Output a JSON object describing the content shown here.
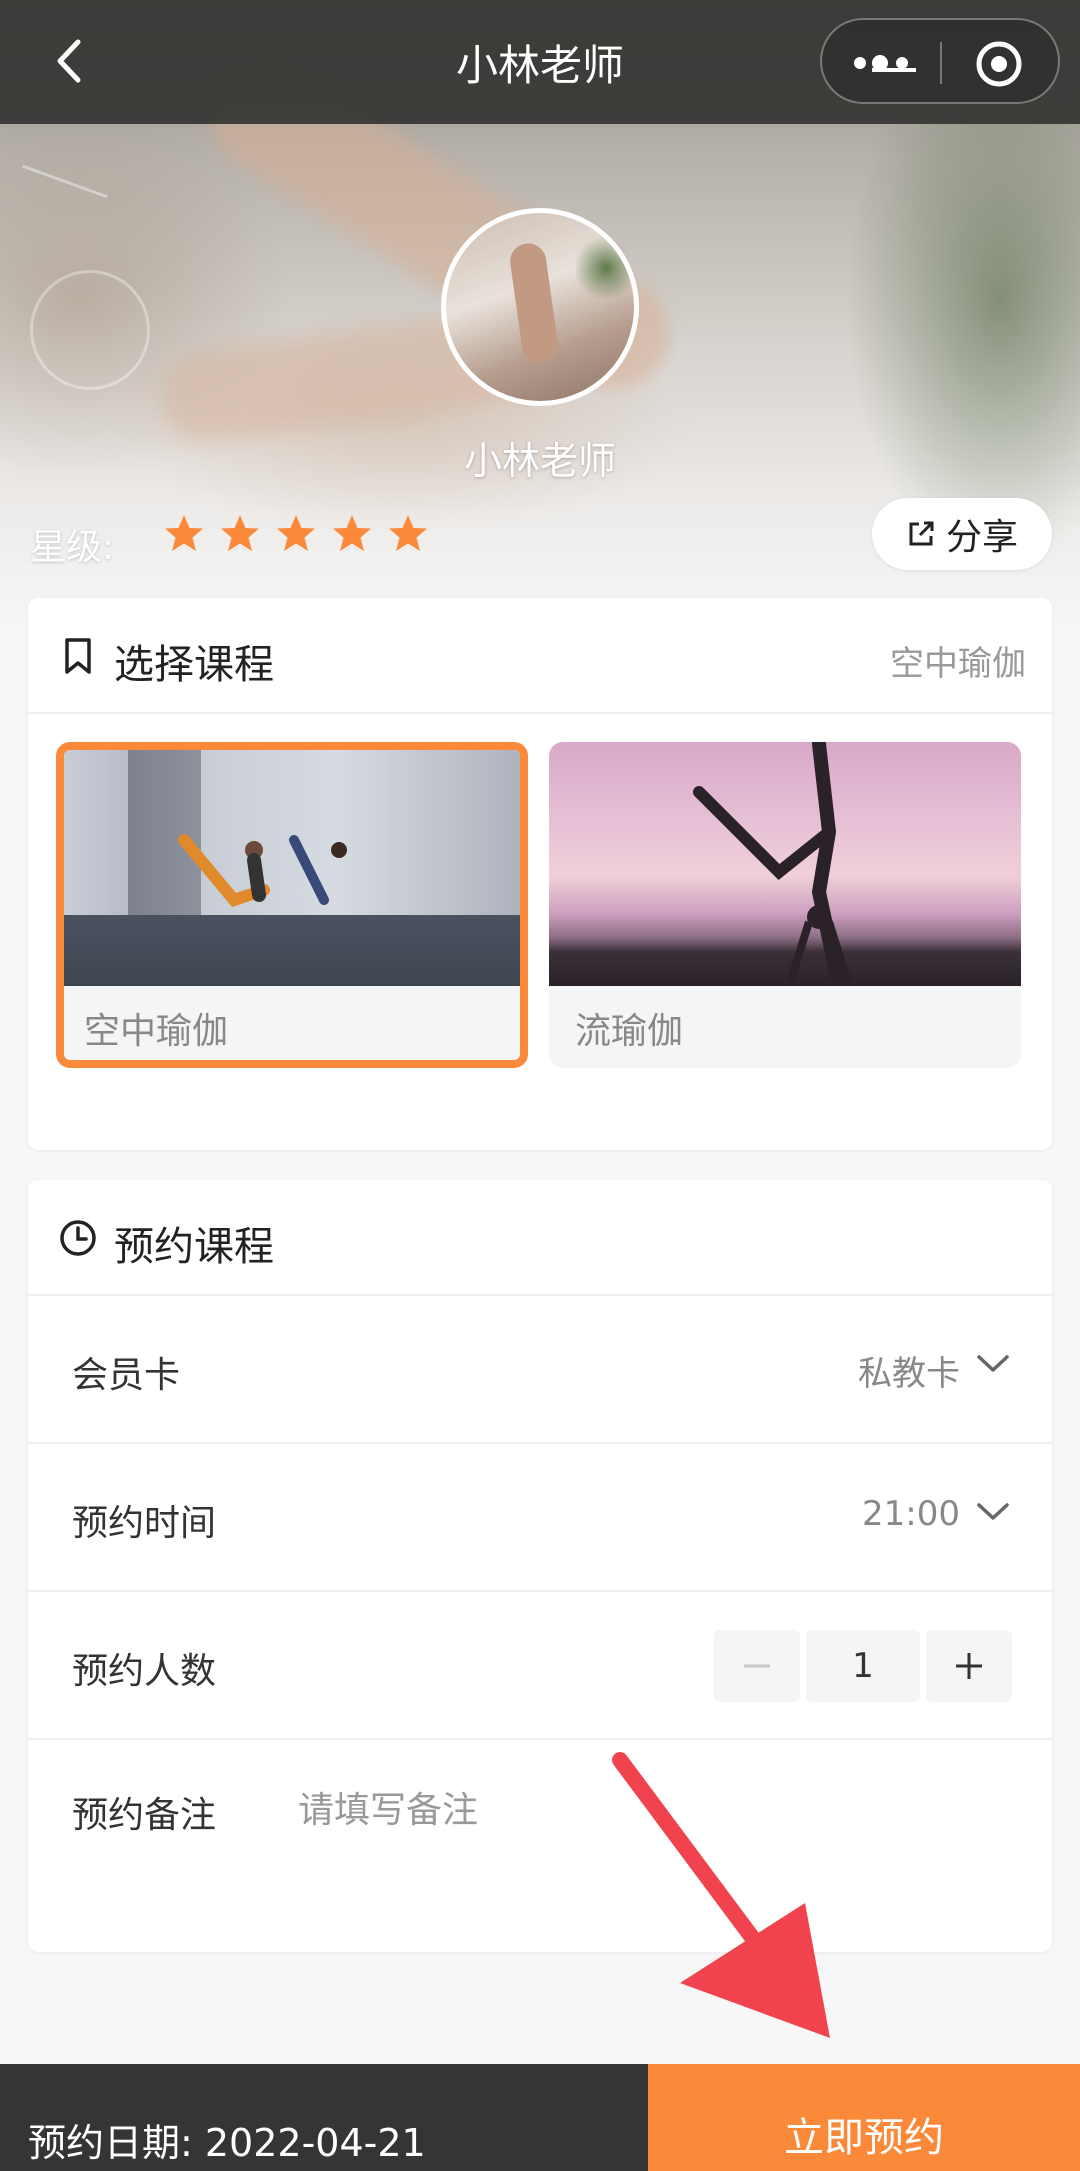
{
  "nav": {
    "title": "小林老师",
    "back_icon": "chevron-left-icon",
    "more_icon": "more-dots-icon",
    "target_icon": "target-icon"
  },
  "profile": {
    "name": "小林老师",
    "rating_label": "星级:",
    "stars": 5,
    "share_label": "分享"
  },
  "select_course": {
    "title": "选择课程",
    "selected": "空中瑜伽",
    "courses": [
      {
        "label": "空中瑜伽",
        "selected": true
      },
      {
        "label": "流瑜伽",
        "selected": false
      }
    ]
  },
  "booking": {
    "title": "预约课程",
    "card": {
      "label": "会员卡",
      "value": "私教卡"
    },
    "time": {
      "label": "预约时间",
      "value": "21:00"
    },
    "people": {
      "label": "预约人数",
      "value": "1",
      "minus": "−",
      "plus": "+"
    },
    "note": {
      "label": "预约备注",
      "placeholder": "请填写备注"
    }
  },
  "footer": {
    "date_label": "预约日期: 2022-04-21",
    "book_button": "立即预约"
  },
  "colors": {
    "accent": "#fa8a3a",
    "star": "#fa8a3a",
    "footer_bg": "#353535",
    "annotation_arrow": "#f0434e"
  }
}
